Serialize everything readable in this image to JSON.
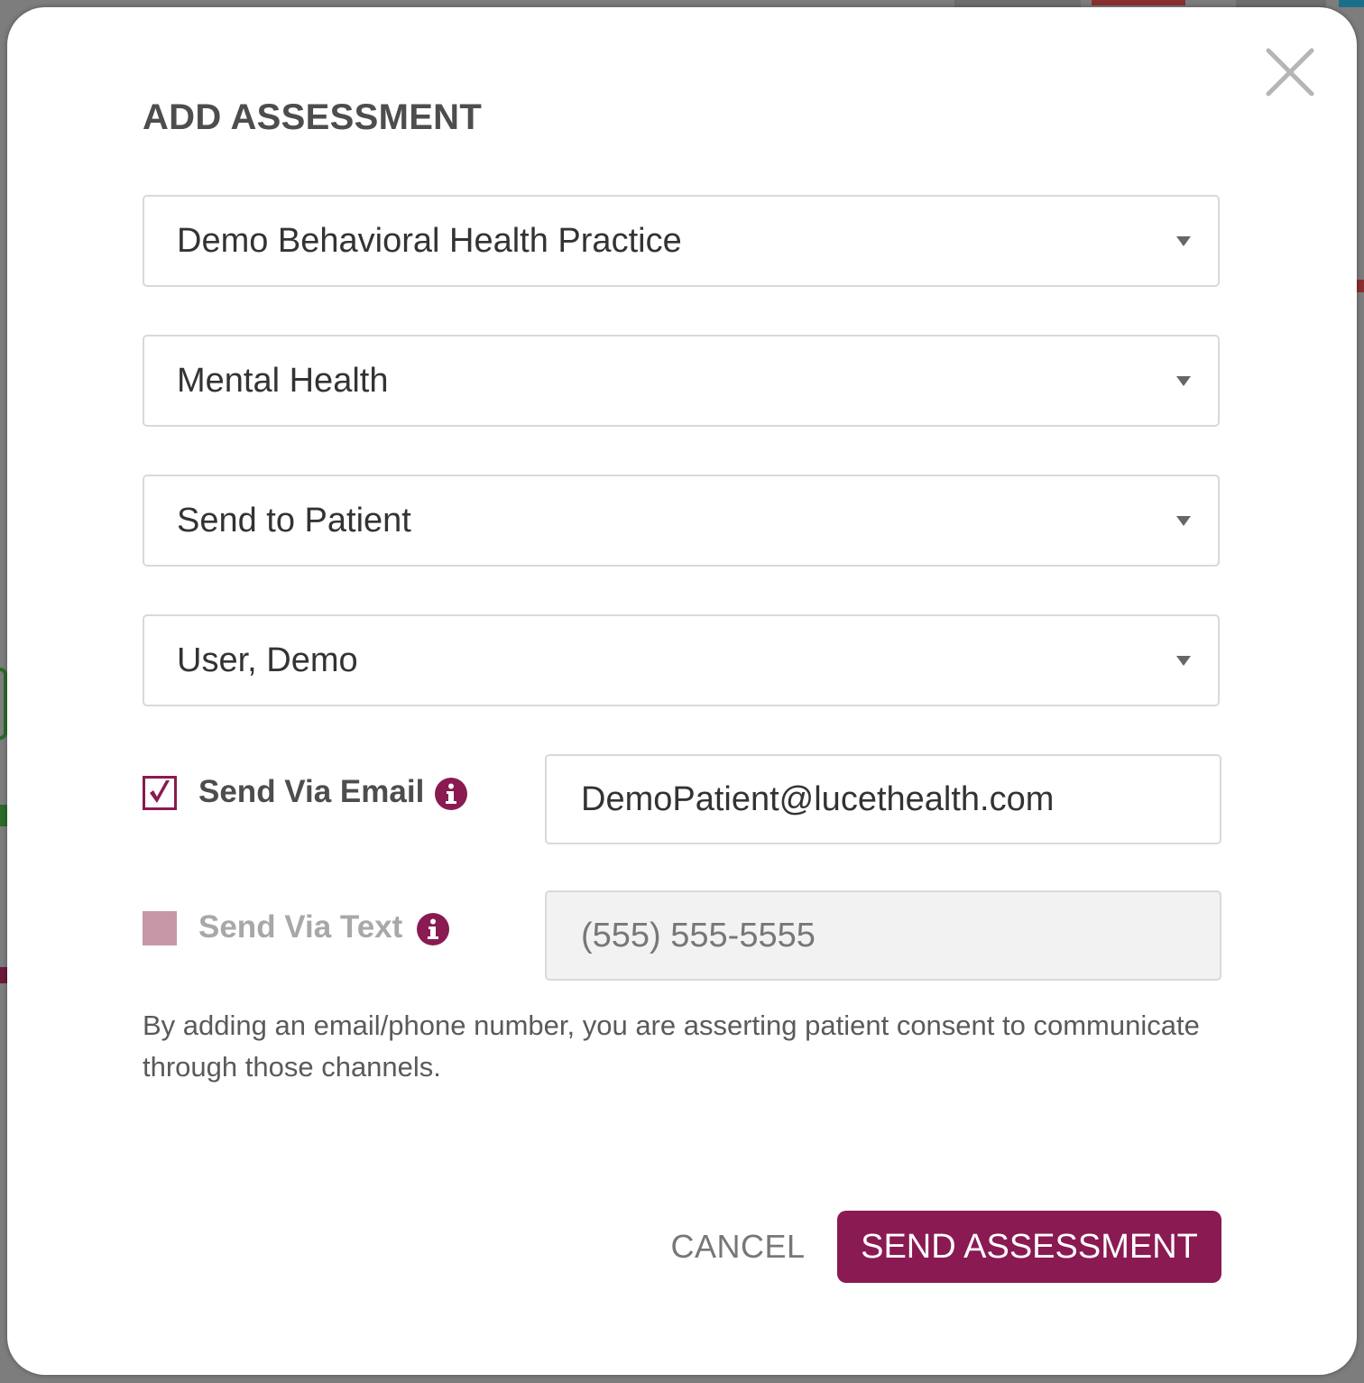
{
  "modal": {
    "title": "ADD ASSESSMENT",
    "close_icon": "close-icon"
  },
  "selects": {
    "practice": "Demo Behavioral Health Practice",
    "category": "Mental Health",
    "recipient": "Send to Patient",
    "patient": "User, Demo"
  },
  "email": {
    "label": "Send Via Email",
    "checked": true,
    "value": "DemoPatient@lucethealth.com"
  },
  "text": {
    "label": "Send Via Text",
    "checked": false,
    "placeholder": "(555) 555-5555"
  },
  "consent_text": "By adding an email/phone number, you are asserting patient consent to communicate through those channels.",
  "buttons": {
    "cancel": "CANCEL",
    "send": "SEND ASSESSMENT"
  },
  "colors": {
    "accent": "#8a1a52",
    "checkbox_disabled": "#c797a8"
  }
}
